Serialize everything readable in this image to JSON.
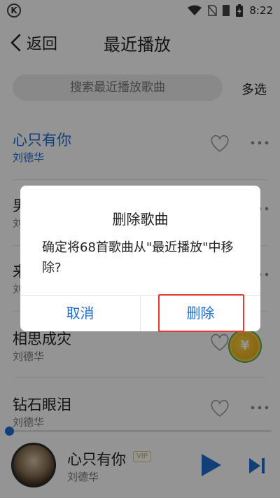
{
  "status_bar": {
    "app_icon": "K",
    "time": "8:22",
    "icons": [
      "wifi-icon",
      "no-sim-icon",
      "signal-icon",
      "battery-charging-icon"
    ]
  },
  "header": {
    "back_label": "返回",
    "title": "最近播放"
  },
  "search": {
    "placeholder": "搜索最近播放歌曲"
  },
  "multiselect_label": "多选",
  "songs": [
    {
      "title": "心只有你",
      "artist": "刘德华"
    },
    {
      "title": "男",
      "artist": "刘"
    },
    {
      "title": "来",
      "artist": "刘"
    },
    {
      "title": "相思成灾",
      "artist": "刘德华"
    },
    {
      "title": "钻石眼泪",
      "artist": "刘德华"
    }
  ],
  "now_playing": {
    "title": "心只有你",
    "badge": "VIP",
    "artist": "刘德华",
    "progress": 0.0
  },
  "coin_badge": "¥",
  "dialog": {
    "title": "删除歌曲",
    "message": "确定将68首歌曲从\"最近播放\"中移除?",
    "cancel_label": "取消",
    "delete_label": "删除"
  },
  "colors": {
    "accent": "#1e6fd0",
    "highlight": "#e53935"
  }
}
